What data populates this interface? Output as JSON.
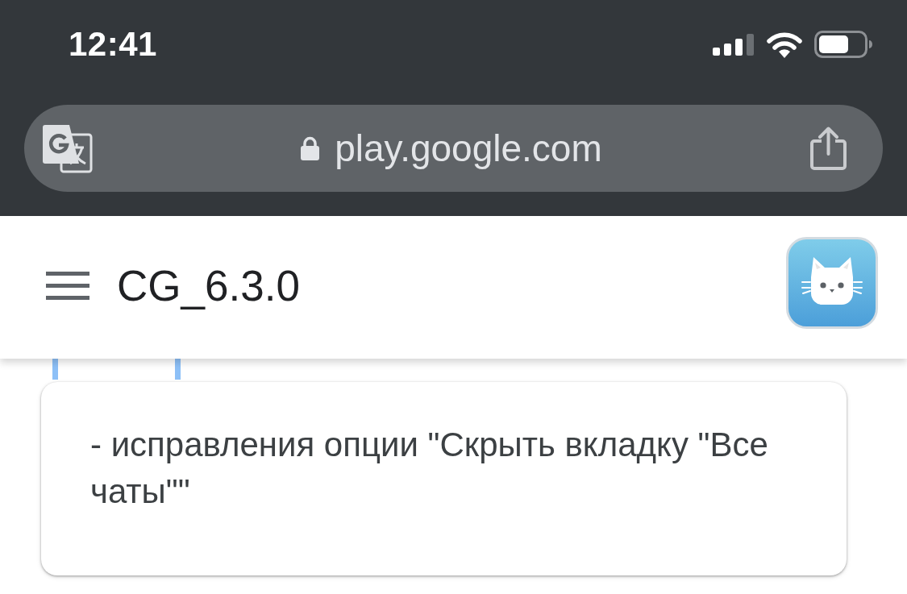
{
  "status_bar": {
    "time": "12:41"
  },
  "address_bar": {
    "url": "play.google.com"
  },
  "header": {
    "title": "CG_6.3.0"
  },
  "card": {
    "text": "- исправления опции \"Скрыть вкладку \"Все чаты\"\""
  }
}
